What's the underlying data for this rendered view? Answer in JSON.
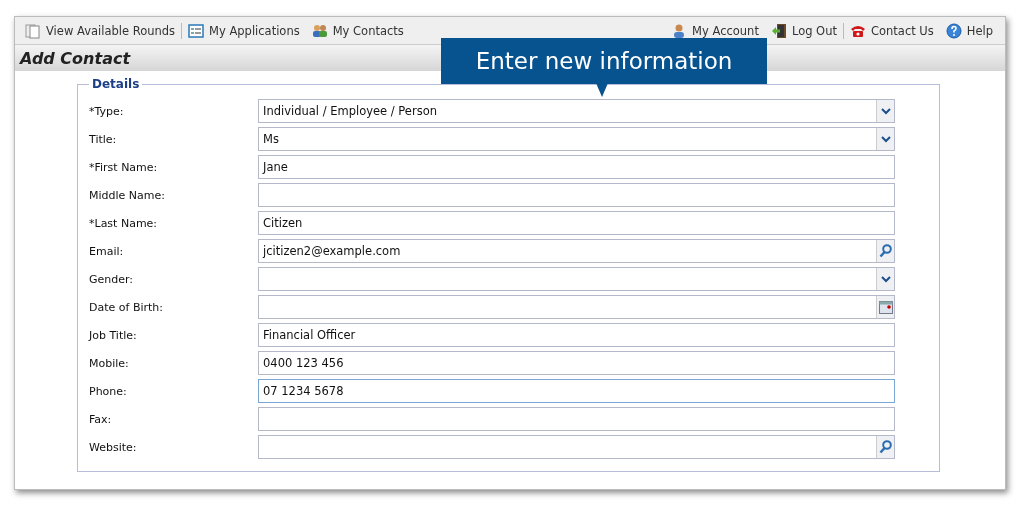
{
  "toolbar": {
    "left": [
      {
        "label": "View Available Rounds"
      },
      {
        "label": "My Applications"
      },
      {
        "label": "My Contacts"
      }
    ],
    "right": [
      {
        "label": "My Account"
      },
      {
        "label": "Log Out"
      },
      {
        "label": "Contact Us"
      },
      {
        "label": "Help"
      }
    ]
  },
  "page_title": "Add Contact",
  "callout": "Enter new information",
  "details": {
    "legend": "Details",
    "fields": [
      {
        "label": "*Type:",
        "kind": "select",
        "value": "Individual / Employee / Person",
        "focused": false
      },
      {
        "label": "Title:",
        "kind": "select",
        "value": "Ms",
        "focused": false
      },
      {
        "label": "*First Name:",
        "kind": "text",
        "value": "Jane",
        "focused": false
      },
      {
        "label": "Middle Name:",
        "kind": "text",
        "focused": false
      },
      {
        "label": "*Last Name:",
        "kind": "text",
        "value": "Citizen",
        "focused": false
      },
      {
        "label": "Email:",
        "kind": "search",
        "value": "jcitizen2@example.com",
        "focused": false
      },
      {
        "label": "Gender:",
        "kind": "select",
        "focused": false
      },
      {
        "label": "Date of Birth:",
        "kind": "date",
        "focused": false
      },
      {
        "label": "Job Title:",
        "kind": "text",
        "value": "Financial Officer",
        "focused": false
      },
      {
        "label": "Mobile:",
        "kind": "text",
        "value": "0400 123 456",
        "focused": false
      },
      {
        "label": "Phone:",
        "kind": "text",
        "value": "07 1234 5678",
        "focused": true
      },
      {
        "label": "Fax:",
        "kind": "text",
        "focused": false
      },
      {
        "label": "Website:",
        "kind": "search",
        "focused": false
      }
    ]
  }
}
